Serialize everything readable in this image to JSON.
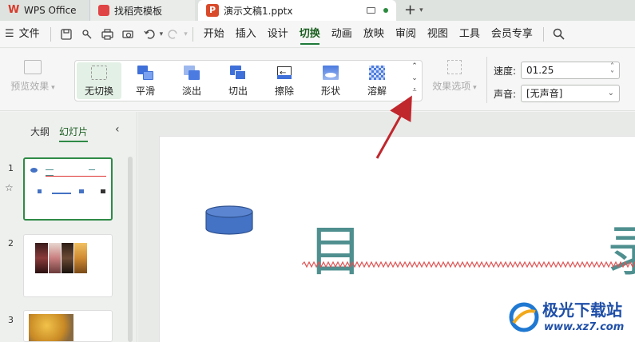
{
  "tabs": {
    "app": "WPS Office",
    "template": "找稻壳模板",
    "document": "演示文稿1.pptx"
  },
  "menubar": {
    "file": "文件",
    "items": [
      "开始",
      "插入",
      "设计",
      "切换",
      "动画",
      "放映",
      "审阅",
      "视图",
      "工具",
      "会员专享"
    ],
    "active": "切换"
  },
  "ribbon": {
    "preview": "预览效果",
    "effects": [
      "无切换",
      "平滑",
      "淡出",
      "切出",
      "擦除",
      "形状",
      "溶解"
    ],
    "selected_effect": "无切换",
    "effect_options": "效果选项",
    "speed_label": "速度:",
    "speed_value": "01.25",
    "sound_label": "声音:",
    "sound_value": "[无声音]"
  },
  "leftpanel": {
    "tab_outline": "大纲",
    "tab_slides": "幻灯片",
    "slides": [
      "1",
      "2",
      "3"
    ]
  },
  "slide": {
    "char1": "目",
    "char2": "录"
  },
  "watermark": {
    "title": "极光下载站",
    "url": "www.xz7.com"
  },
  "colors": {
    "accent": "#2f8a46",
    "shape_fill": "#4472c4",
    "arrow": "#c0272d"
  }
}
